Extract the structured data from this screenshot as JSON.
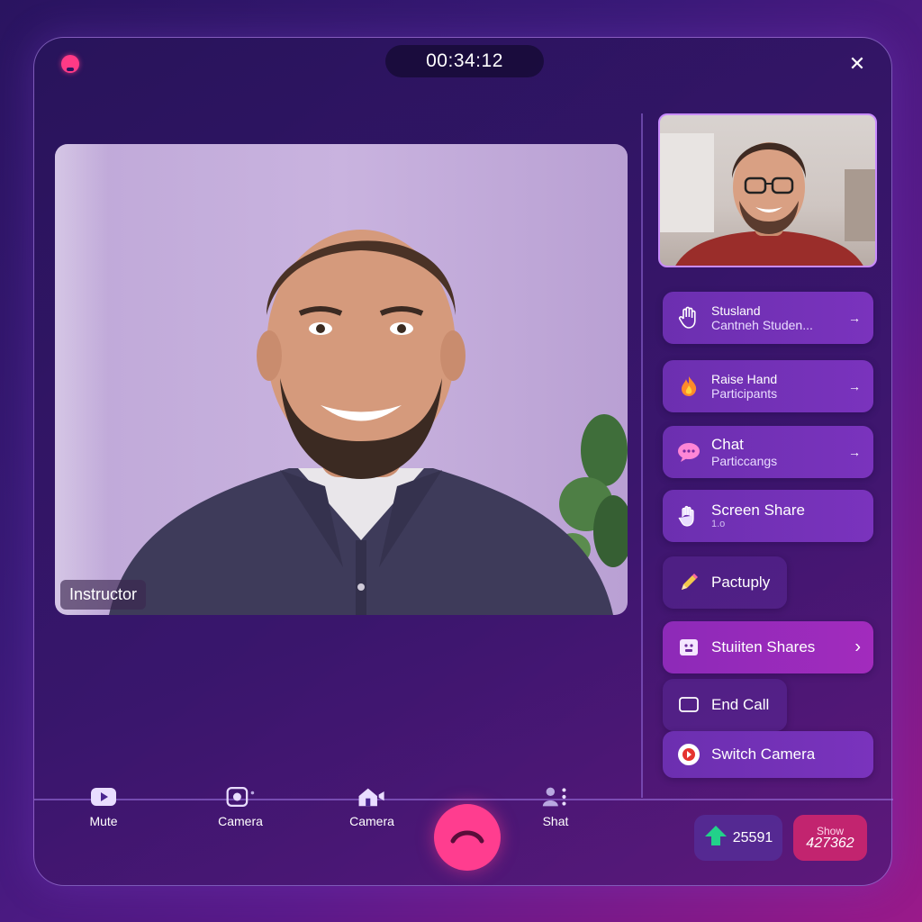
{
  "header": {
    "timer": "00:34:12",
    "close_label": "✕"
  },
  "main_video": {
    "participant_label": "Instructor"
  },
  "side_panel": {
    "buttons": [
      {
        "line1": "Stusland",
        "line2": "Cantneh Studen...",
        "icon": "hand-icon"
      },
      {
        "line1": "Raise Hand",
        "line2": "Participants",
        "icon": "fire-icon"
      },
      {
        "line1": "Chat",
        "line2": "Particcangs",
        "icon": "chat-bubble-icon"
      },
      {
        "line1": "Screen Share",
        "line2": "1.o",
        "icon": "raised-hand-icon"
      },
      {
        "line1": "Pactuply",
        "icon": "pencil-icon"
      },
      {
        "line1": "Stuiiten Shares",
        "icon": "screen-face-icon"
      },
      {
        "line1": "End Call",
        "icon": "screen-icon"
      },
      {
        "line1": "Switch Camera",
        "icon": "camera-switch-icon"
      }
    ],
    "arrow": "→",
    "chevron": "›"
  },
  "bottom_bar": {
    "items": [
      {
        "label": "Mute",
        "icon": "video-play-icon"
      },
      {
        "label": "Camera",
        "icon": "camera-icon"
      },
      {
        "label": "Camera",
        "icon": "home-camera-icon"
      },
      {
        "label": "Shat",
        "icon": "participants-icon"
      }
    ],
    "stat_1": {
      "value": "25591"
    },
    "stat_2": {
      "label": "Show",
      "value": "427362"
    }
  },
  "colors": {
    "accent_pink": "#ff3d8f",
    "panel_purple": "#7a33bd",
    "border_lilac": "#c98cff"
  }
}
